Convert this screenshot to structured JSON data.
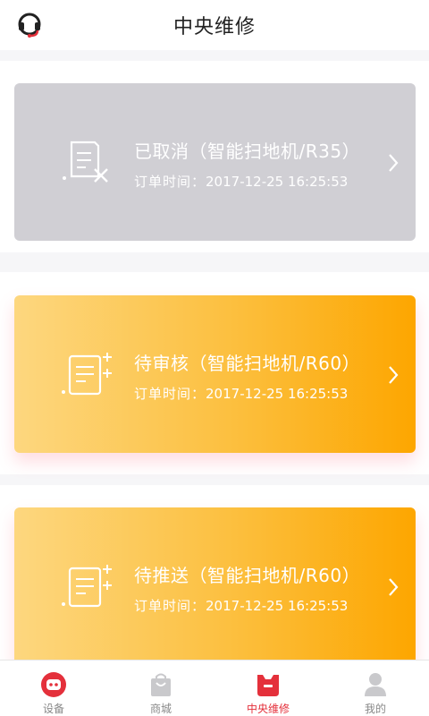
{
  "header": {
    "title": "中央维修",
    "left_icon": "headset-icon"
  },
  "orders": [
    {
      "status": "已取消（智能扫地机/R35）",
      "time_label": "订单时间：",
      "time": "2017-12-25 16:25:53",
      "state": "cancelled",
      "icon": "document-x-icon"
    },
    {
      "status": "待审核（智能扫地机/R60）",
      "time_label": "订单时间：",
      "time": "2017-12-25 16:25:53",
      "state": "pending",
      "icon": "document-plus-icon"
    },
    {
      "status": "待推送（智能扫地机/R60）",
      "time_label": "订单时间：",
      "time": "2017-12-25 16:25:53",
      "state": "pending",
      "icon": "document-plus-icon"
    }
  ],
  "tabs": [
    {
      "label": "设备",
      "icon": "robot-icon",
      "active": false
    },
    {
      "label": "商城",
      "icon": "shopping-bag-icon",
      "active": false
    },
    {
      "label": "中央维修",
      "icon": "repair-icon",
      "active": true
    },
    {
      "label": "我的",
      "icon": "user-icon",
      "active": false
    }
  ],
  "colors": {
    "accent": "#e4303b",
    "card_orange_start": "#fdd77f",
    "card_orange_end": "#fda600",
    "card_cancelled": "#d0cfd4"
  }
}
